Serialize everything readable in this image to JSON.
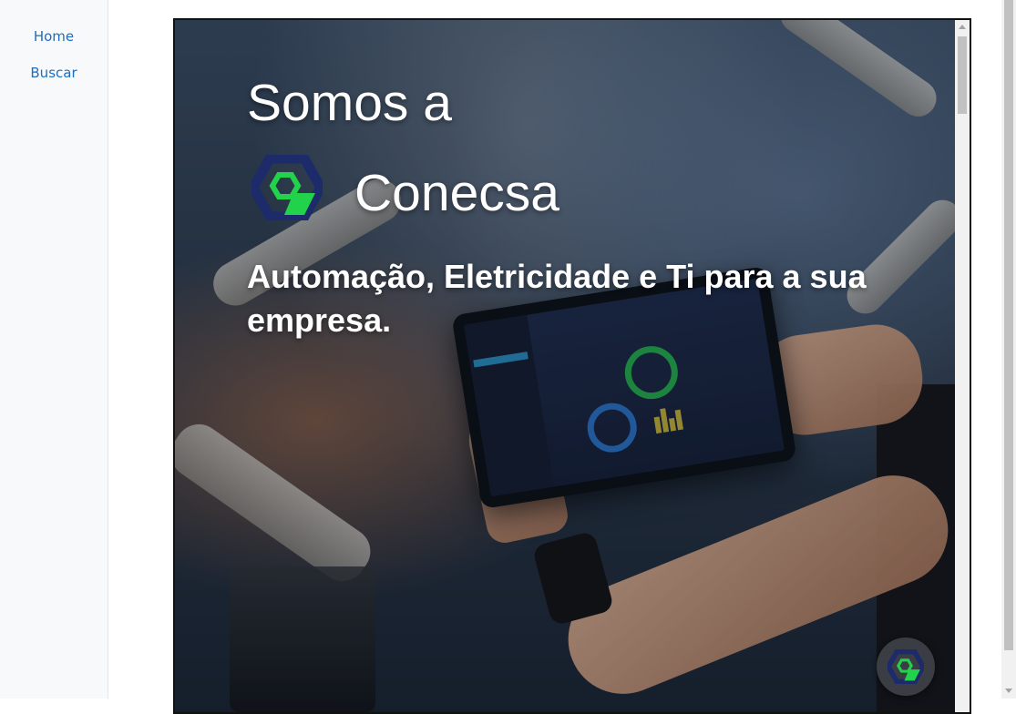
{
  "sidebar": {
    "items": [
      {
        "label": "Home"
      },
      {
        "label": "Buscar"
      }
    ]
  },
  "hero": {
    "headline": "Somos a",
    "brand_name": "Conecsa",
    "tagline": "Automação, Eletricidade e Ti para a sua empresa.",
    "background_image": "industrial-automation-tablet-photo"
  },
  "colors": {
    "link": "#1b6ec2",
    "logo_navy": "#1d2b6b",
    "logo_green": "#22d24a",
    "hero_text": "#ffffff",
    "fab_bg": "#3a3e44"
  },
  "icons": {
    "brand_logo": "conecsa-hexagon-logo",
    "fab_icon": "conecsa-hexagon-logo"
  }
}
